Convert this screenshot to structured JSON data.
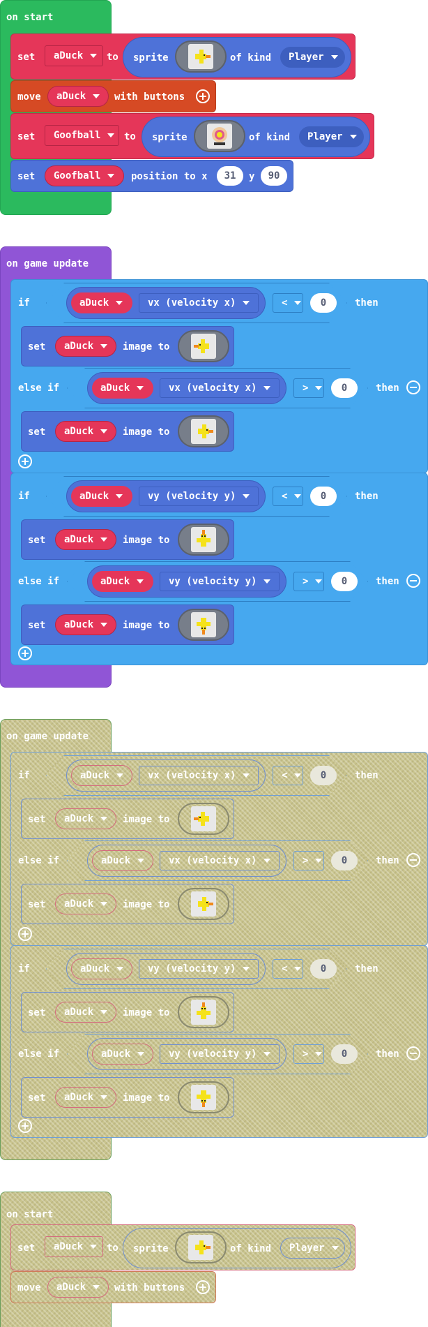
{
  "colors": {
    "events": "#2bba5e",
    "loops": "#9055d6",
    "logic": "#46a8ef",
    "sprites": "#4e72d8",
    "var": "#e53659",
    "controller": "#d64a24",
    "disabled": "#c9c48e"
  },
  "kw": {
    "on_start": "on start",
    "set": "set",
    "to": "to",
    "sprite": "sprite",
    "of_kind": "of kind",
    "move": "move",
    "with_buttons": "with buttons",
    "position_to_x": "position to x",
    "y": "y",
    "on_game_update": "on game update",
    "if": "if",
    "then": "then",
    "else_if": "else if",
    "image_to": "image to"
  },
  "vars": {
    "duck": "aDuck",
    "goof": "Goofball",
    "kind": "Player"
  },
  "props": {
    "vx": "vx (velocity x)",
    "vy": "vy (velocity y)"
  },
  "ops": {
    "lt": "<",
    "gt": ">"
  },
  "nums": {
    "zero": "0",
    "x": "31",
    "y": "90"
  },
  "icons": {
    "left": "duck-left-icon",
    "right": "duck-right-icon",
    "up": "duck-up-icon",
    "down": "duck-down-icon",
    "ball": "goofball-icon"
  }
}
